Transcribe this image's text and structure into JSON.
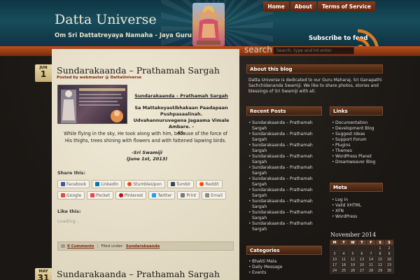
{
  "header": {
    "site_title": "Datta Universe",
    "tagline": "Om Sri Dattatreyaya Namaha - Jaya Guru Datta!",
    "subscribe": "Subscribe to feed",
    "nav": [
      "Home",
      "About",
      "Terms of Service"
    ]
  },
  "search": {
    "label": "search",
    "placeholder": "Search, type and hit enter"
  },
  "posts": [
    {
      "month": "JUN",
      "day": "1",
      "title": "Sundarakaanda – Prathamah Sargah",
      "meta": "Posted by webmaster @ DattaUniverse",
      "excerpt_title": "Sundarakaanda – Prathamah Sargah",
      "excerpt_lines": [
        "Sa Mattakoyastibhakaan Paadapaan",
        "Pushpasaalinah.",
        "Udvahannuruvegena Jagaama Vimale Ambare. -",
        "45-"
      ],
      "excerpt_body": "While flying in the sky, He took along with him, because of the force of His thighs, trees shining with flowers and with fattened lapwing birds.",
      "excerpt_sig": [
        "-Sri Swamiji",
        "(June 1st, 2013)"
      ],
      "share_label": "Share this:",
      "share_row1": [
        "Facebook",
        "LinkedIn",
        "StumbleUpon",
        "Tumblr",
        "Reddit"
      ],
      "share_row2": [
        "Google",
        "Pocket",
        "Pinterest",
        "Twitter",
        "Print",
        "Email"
      ],
      "like_label": "Like this:",
      "loading": "Loading...",
      "comments": "0 Comments",
      "filed_label": "Filed under:",
      "category": "Sundarakaanda"
    },
    {
      "month": "MAY",
      "day": "31",
      "title": "Sundarakaanda – Prathamah Sargah"
    }
  ],
  "sidebar": {
    "about_title": "About this blog",
    "about_text": "Datta Universe is dedicated to our Guru Maharaj, Sri Ganapathi Sachchidananda Swamiji. We like to share photos, stories and blessings of Sri Swamiji with all.",
    "recent_title": "Recent Posts",
    "recent_posts": [
      "Sundarakaanda – Prathamah Sargah",
      "Sundarakaanda – Prathamah Sargah",
      "Sundarakaanda – Prathamah Sargah",
      "Sundarakaanda – Prathamah Sargah",
      "Sundarakaanda – Prathamah Sargah",
      "Sundarakaanda – Prathamah Sargah",
      "Sundarakaanda – Prathamah Sargah",
      "Sundarakaanda – Prathamah Sargah",
      "Sundarakaanda – Prathamah Sargah",
      "Sundarakaanda – Prathamah Sargah"
    ],
    "links_title": "Links",
    "links": [
      "Documentation",
      "Development Blog",
      "Suggest Ideas",
      "Support Forum",
      "Plugins",
      "Themes",
      "WordPress Planet",
      "Dreamweaver Blog"
    ],
    "meta_title": "Meta",
    "meta": [
      "Log in",
      "Valid XHTML",
      "XFN",
      "WordPress"
    ],
    "categories_title": "Categories",
    "categories": [
      "Bhakti Mala",
      "Daily Message",
      "Events"
    ],
    "calendar_title": "November 2014",
    "calendar_days": [
      "M",
      "T",
      "W",
      "T",
      "F",
      "S",
      "S"
    ],
    "calendar_rows": [
      [
        "",
        "",
        "",
        "",
        "",
        "1",
        "2"
      ],
      [
        "3",
        "4",
        "5",
        "6",
        "7",
        "8",
        "9"
      ],
      [
        "10",
        "11",
        "12",
        "13",
        "14",
        "15",
        "16"
      ],
      [
        "17",
        "18",
        "19",
        "20",
        "21",
        "22",
        "23"
      ],
      [
        "24",
        "25",
        "26",
        "27",
        "28",
        "29",
        "30"
      ]
    ]
  }
}
